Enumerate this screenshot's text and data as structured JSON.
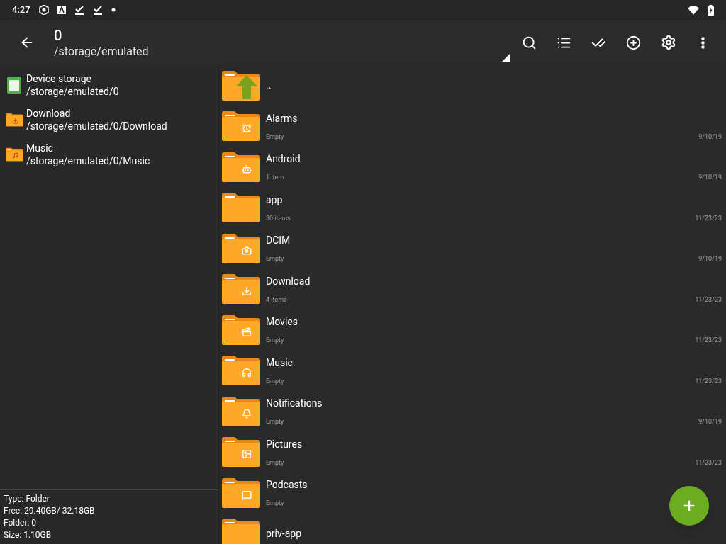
{
  "status_bar": {
    "time": "4:27"
  },
  "toolbar": {
    "title": "0",
    "path": "/storage/emulated"
  },
  "bookmarks": [
    {
      "kind": "storage",
      "name": "Device storage",
      "path": "/storage/emulated/0"
    },
    {
      "kind": "download",
      "name": "Download",
      "path": "/storage/emulated/0/Download"
    },
    {
      "kind": "music",
      "name": "Music",
      "path": "/storage/emulated/0/Music"
    }
  ],
  "info": [
    "Type: Folder",
    "Free: 29.40GB/ 32.18GB",
    "Folder: 0",
    "Size: 1.10GB"
  ],
  "files": [
    {
      "kind": "up",
      "name": ".."
    },
    {
      "kind": "alarm",
      "name": "Alarms",
      "detail": "Empty",
      "date": "9/10/19"
    },
    {
      "kind": "android",
      "name": "Android",
      "detail": "1 item",
      "date": "9/10/19"
    },
    {
      "kind": "plain",
      "name": "app",
      "detail": "30 items",
      "date": "11/23/23"
    },
    {
      "kind": "camera",
      "name": "DCIM",
      "detail": "Empty",
      "date": "9/10/19"
    },
    {
      "kind": "download",
      "name": "Download",
      "detail": "4 items",
      "date": "11/23/23"
    },
    {
      "kind": "movie",
      "name": "Movies",
      "detail": "Empty",
      "date": "11/23/23"
    },
    {
      "kind": "music",
      "name": "Music",
      "detail": "Empty",
      "date": "11/23/23"
    },
    {
      "kind": "bell",
      "name": "Notifications",
      "detail": "Empty",
      "date": "9/10/19"
    },
    {
      "kind": "image",
      "name": "Pictures",
      "detail": "Empty",
      "date": "11/23/23"
    },
    {
      "kind": "chat",
      "name": "Podcasts",
      "detail": "Empty"
    },
    {
      "kind": "plain",
      "name": "priv-app"
    }
  ]
}
